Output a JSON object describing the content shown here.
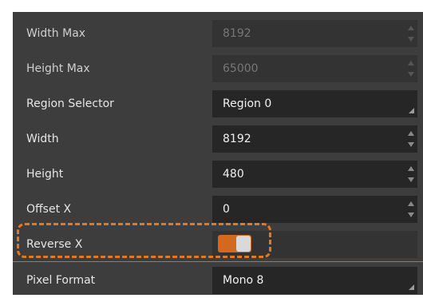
{
  "properties": [
    {
      "label": "Width Max",
      "value": "8192",
      "kind": "spin",
      "disabled": true
    },
    {
      "label": "Height Max",
      "value": "65000",
      "kind": "spin",
      "disabled": true
    },
    {
      "label": "Region Selector",
      "value": "Region 0",
      "kind": "combo",
      "disabled": false
    },
    {
      "label": "Width",
      "value": "8192",
      "kind": "spin",
      "disabled": false
    },
    {
      "label": "Height",
      "value": "480",
      "kind": "spin",
      "disabled": false
    },
    {
      "label": "Offset X",
      "value": "0",
      "kind": "spin",
      "disabled": false
    },
    {
      "label": "Reverse X",
      "value": true,
      "kind": "toggle",
      "disabled": false
    },
    {
      "label": "Pixel Format",
      "value": "Mono 8",
      "kind": "combo",
      "disabled": false
    }
  ],
  "colors": {
    "panel_bg": "#3d3d3d",
    "field_bg": "#262626",
    "accent": "#d2691e",
    "highlight": "#e6771c"
  }
}
